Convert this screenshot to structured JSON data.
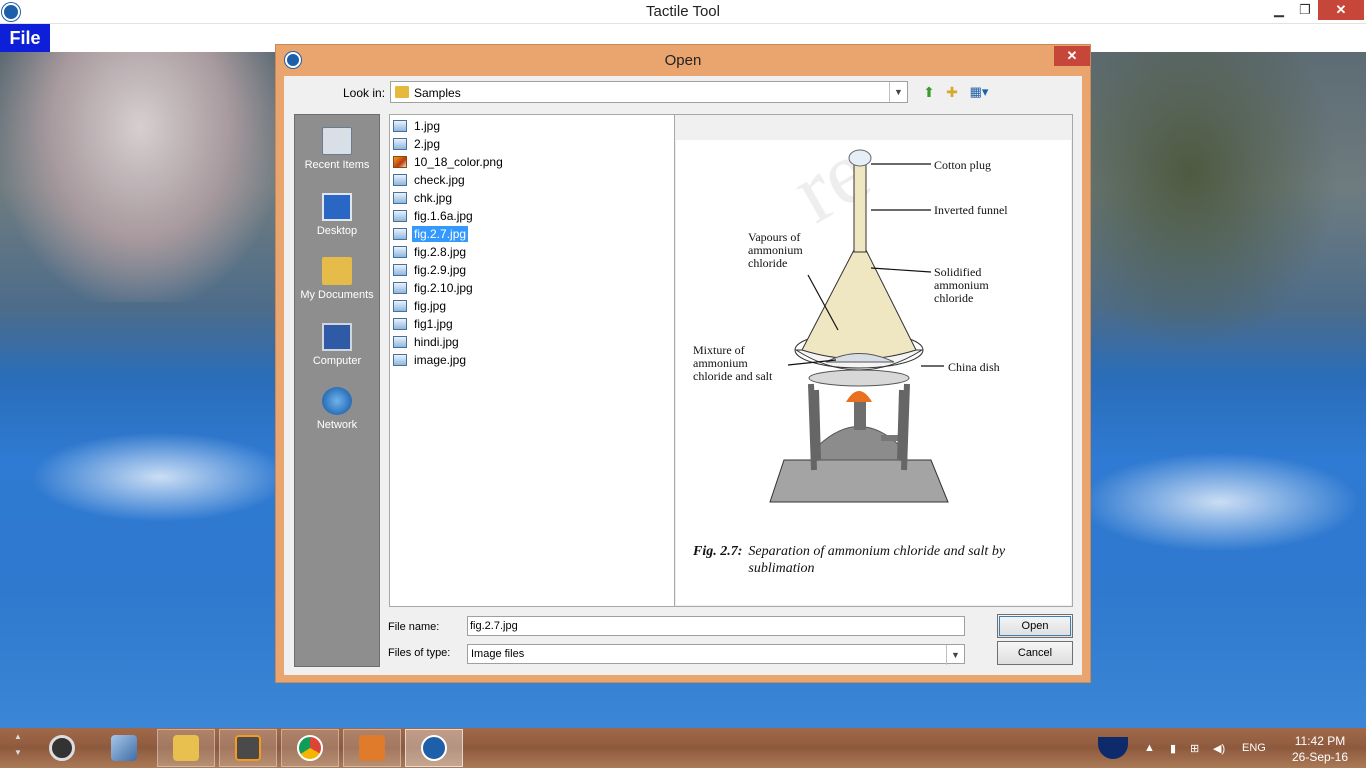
{
  "app": {
    "title": "Tactile Tool",
    "menu_file": "File"
  },
  "window_controls": {
    "minimize": "▁",
    "maximize": "❐",
    "close": "✕"
  },
  "dialog": {
    "title": "Open",
    "close": "✕",
    "look_in_label": "Look in:",
    "look_in_value": "Samples",
    "places": [
      {
        "label": "Recent Items",
        "icon": "recent-items-icon"
      },
      {
        "label": "Desktop",
        "icon": "desktop-icon"
      },
      {
        "label": "My Documents",
        "icon": "my-documents-icon"
      },
      {
        "label": "Computer",
        "icon": "computer-icon"
      },
      {
        "label": "Network",
        "icon": "network-icon"
      }
    ],
    "files": [
      "1.jpg",
      "2.jpg",
      "10_18_color.png",
      "check.jpg",
      "chk.jpg",
      "fig.1.6a.jpg",
      "fig.2.7.jpg",
      "fig.2.8.jpg",
      "fig.2.9.jpg",
      "fig.2.10.jpg",
      "fig.jpg",
      "fig1.jpg",
      "hindi.jpg",
      "image.jpg"
    ],
    "selected_file": "fig.2.7.jpg",
    "file_name_label": "File name:",
    "file_name_value": "fig.2.7.jpg",
    "file_type_label": "Files of type:",
    "file_type_value": "Image files",
    "open_button": "Open",
    "cancel_button": "Cancel"
  },
  "preview": {
    "labels": {
      "cotton_plug": "Cotton plug",
      "inverted_funnel": "Inverted funnel",
      "vapours_1": "Vapours of",
      "vapours_2": "ammonium",
      "vapours_3": "chloride",
      "solidified_1": "Solidified",
      "solidified_2": "ammonium",
      "solidified_3": "chloride",
      "mixture_1": "Mixture of",
      "mixture_2": "ammonium",
      "mixture_3": "chloride and salt",
      "china_dish": "China dish"
    },
    "caption_fig": "Fig. 2.7:",
    "caption_text": "Separation of ammonium chloride and salt by sublimation"
  },
  "taskbar": {
    "items": [
      "media-player-icon",
      "virtualbox-icon",
      "file-explorer-icon",
      "sublime-text-icon",
      "chrome-icon",
      "presentation-icon",
      "tactile-tool-icon"
    ],
    "language": "ENG",
    "time": "11:42 PM",
    "date": "26-Sep-16"
  },
  "colors": {
    "dialog_frame": "#eaa56e",
    "menu_file_bg": "#0d1fd8",
    "selection": "#3399ff",
    "taskbar": "#9a6446"
  }
}
